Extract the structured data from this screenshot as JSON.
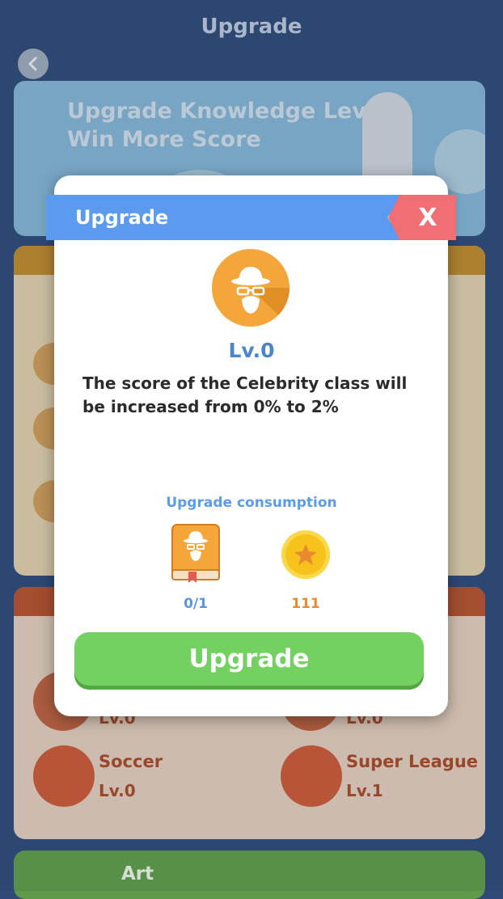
{
  "header": {
    "title": "Upgrade"
  },
  "banner": {
    "line1": "Upgrade Knowledge Level",
    "line2": "Win More Score"
  },
  "sports_card": {
    "items": [
      {
        "name": "Soccer",
        "level": "Lv.0"
      },
      {
        "name": "Super League",
        "level": "Lv.1"
      }
    ],
    "hidden_levels": [
      "Lv.0",
      "Lv.0"
    ]
  },
  "art_card": {
    "title": "Art"
  },
  "modal": {
    "title": "Upgrade",
    "close_label": "X",
    "level": "Lv.0",
    "description": "The score of the Celebrity class will be increased from 0% to 2%",
    "consumption_label": "Upgrade consumption",
    "book_count": "0/1",
    "coin_count": "111",
    "button_label": "Upgrade"
  },
  "colors": {
    "ribbon": "#5b9bef",
    "close": "#ef6f74",
    "button": "#72d160",
    "level_text": "#4a86cc",
    "coin_text": "#e98a2e"
  }
}
